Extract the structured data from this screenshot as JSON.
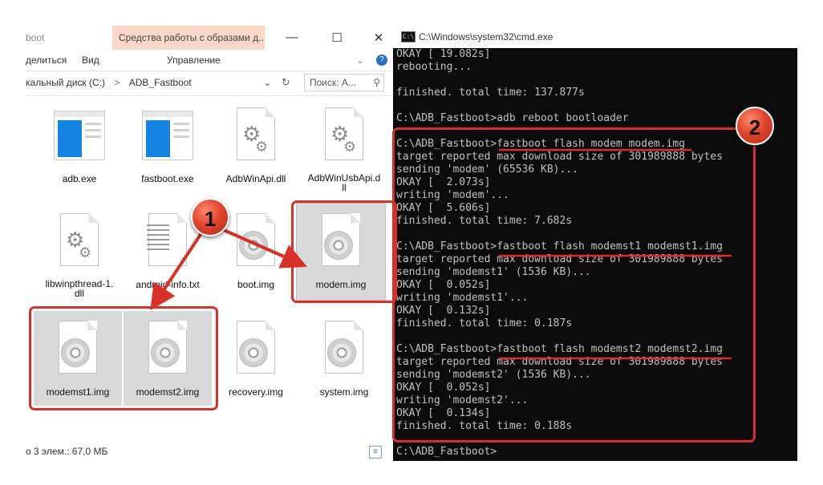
{
  "explorer": {
    "title_fragment": "boot",
    "context_tab": "Средства работы с образами д...",
    "window_controls": {
      "minimize": "—",
      "maximize": "☐",
      "close": "✕"
    },
    "ribbon": {
      "tab_share": "делиться",
      "tab_view": "Вид",
      "tab_manage": "Управление",
      "help": "?",
      "expand": "⌄"
    },
    "address": {
      "drive": "кальный диск (C:)",
      "folder": "ADB_Fastboot",
      "separator": ">"
    },
    "search_placeholder": "Поиск: А...",
    "files": [
      {
        "name": "adb.exe",
        "icon": "application-window-icon"
      },
      {
        "name": "fastboot.exe",
        "icon": "application-window-icon"
      },
      {
        "name": "AdbWinApi.dll",
        "icon": "gear-file-icon"
      },
      {
        "name": "AdbWinUsbApi.d\nll",
        "icon": "gear-file-icon"
      },
      {
        "name": "libwinpthread-1.\ndll",
        "icon": "gear-file-icon"
      },
      {
        "name": "android-info.txt",
        "icon": "text-file-icon"
      },
      {
        "name": "boot.img",
        "icon": "disc-image-icon"
      },
      {
        "name": "modem.img",
        "icon": "disc-image-icon"
      },
      {
        "name": "modemst1.img",
        "icon": "disc-image-icon"
      },
      {
        "name": "modemst2.img",
        "icon": "disc-image-icon"
      },
      {
        "name": "recovery.img",
        "icon": "disc-image-icon"
      },
      {
        "name": "system.img",
        "icon": "disc-image-icon"
      }
    ],
    "status": "о 3 элем.: 67,0 МБ"
  },
  "cmd": {
    "title": "C:\\Windows\\system32\\cmd.exe",
    "window_controls": {
      "minimize": "—",
      "maximize": "☐",
      "close": "✕"
    },
    "lines": [
      "OKAY [ 19.082s]",
      "rebooting...",
      "",
      "finished. total time: 137.877s",
      "",
      "C:\\ADB_Fastboot>adb reboot bootloader",
      "",
      "C:\\ADB_Fastboot>fastboot flash modem modem.img",
      "target reported max download size of 301989888 bytes",
      "sending 'modem' (65536 KB)...",
      "OKAY [  2.073s]",
      "writing 'modem'...",
      "OKAY [  5.606s]",
      "finished. total time: 7.682s",
      "",
      "C:\\ADB_Fastboot>fastboot flash modemst1 modemst1.img",
      "target reported max download size of 301989888 bytes",
      "sending 'modemst1' (1536 KB)...",
      "OKAY [  0.052s]",
      "writing 'modemst1'...",
      "OKAY [  0.132s]",
      "finished. total time: 0.187s",
      "",
      "C:\\ADB_Fastboot>fastboot flash modemst2 modemst2.img",
      "target reported max download size of 301989888 bytes",
      "sending 'modemst2' (1536 KB)...",
      "OKAY [  0.052s]",
      "writing 'modemst2'...",
      "OKAY [  0.134s]",
      "finished. total time: 0.188s",
      "",
      "C:\\ADB_Fastboot>"
    ]
  },
  "annotations": {
    "badge1": "1",
    "badge2": "2",
    "accent_color": "#d83027"
  }
}
